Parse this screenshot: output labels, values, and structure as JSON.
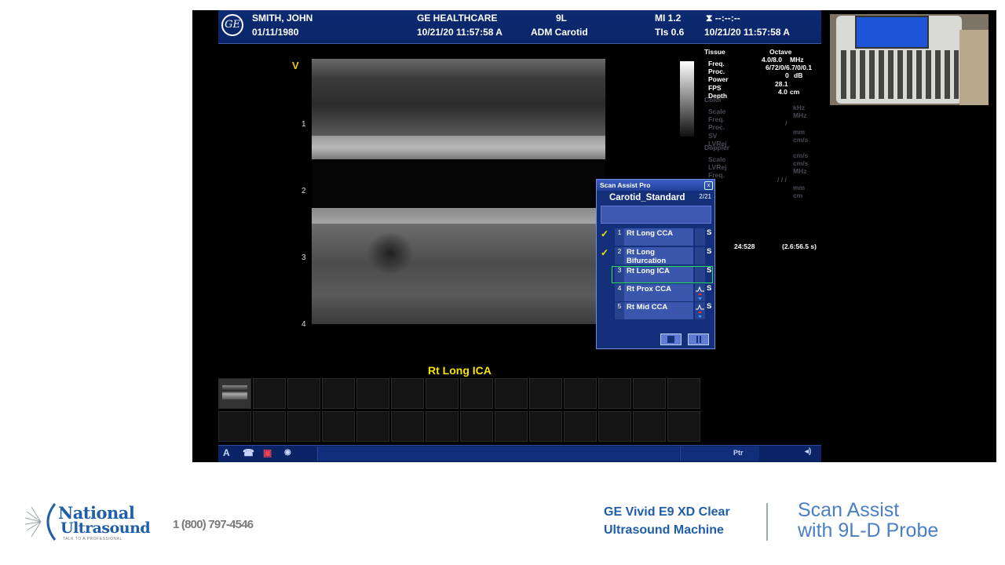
{
  "header": {
    "patient_name": "SMITH, JOHN",
    "patient_dob": "01/11/1980",
    "institution": "GE HEALTHCARE",
    "datetime": "10/21/20 11:57:58 A",
    "probe": "9L",
    "operator_app": "ADM Carotid",
    "mi": "MI 1.2",
    "tis": "TIs 0.6",
    "status_icon_text": "--:--:--",
    "datetime_right": "10/21/20 11:57:58 A",
    "logo_text": "GE"
  },
  "image": {
    "orientation_marker": "V",
    "depth_ticks": [
      "1",
      "2",
      "3",
      "4"
    ],
    "label": "Rt Long ICA"
  },
  "params": {
    "tissue_label": "Tissue",
    "tissue_value": "Octave",
    "rows": [
      {
        "name": "Freq.",
        "value": "4.0/8.0",
        "unit": "MHz"
      },
      {
        "name": "Proc.",
        "value": "6/72/0/6.7/0/0.1",
        "unit": ""
      },
      {
        "name": "Power",
        "value": "0",
        "unit": "dB"
      },
      {
        "name": "FPS",
        "value": "28.1",
        "unit": ""
      },
      {
        "name": "Depth",
        "value": "4.0",
        "unit": "cm"
      }
    ],
    "color_label": "Color",
    "color_rows": [
      {
        "name": "Scale",
        "unit": "kHz"
      },
      {
        "name": "Freq.",
        "unit": "MHz"
      },
      {
        "name": "Proc.",
        "unit": "/"
      },
      {
        "name": "SV",
        "unit": "mm"
      },
      {
        "name": "LVRej",
        "unit": "cm/s"
      }
    ],
    "doppler_label": "Doppler",
    "doppler_rows": [
      {
        "name": "Scale",
        "unit": "cm/s"
      },
      {
        "name": "LVRej",
        "unit": "cm/s"
      },
      {
        "name": "Freq.",
        "unit": "MHz"
      }
    ],
    "extra_units": [
      "/ / /",
      "mm",
      "cm"
    ],
    "time_left": "24:528",
    "time_right": "(2.6:56.5 s)"
  },
  "scan_assist": {
    "title": "Scan Assist Pro",
    "close": "x",
    "protocol": "Carotid_Standard",
    "count": "2/21",
    "steps": [
      {
        "num": "1",
        "label": "Rt Long CCA",
        "done": true,
        "s": "S",
        "check": "✓"
      },
      {
        "num": "2",
        "label": "Rt Long Bifurcation",
        "done": true,
        "s": "S",
        "check": "✓"
      },
      {
        "num": "3",
        "label": "Rt Long ICA",
        "done": false,
        "s": "S",
        "check": ""
      },
      {
        "num": "4",
        "label": "Rt Prox CCA",
        "done": false,
        "s": "S",
        "check": ""
      },
      {
        "num": "5",
        "label": "Rt Mid CCA",
        "done": false,
        "s": "S",
        "check": ""
      }
    ]
  },
  "bottom_bar": {
    "label_a": "A",
    "ptr": "Ptr"
  },
  "footer": {
    "brand_line1": "National",
    "brand_line2": "Ultrasound",
    "brand_tagline": "TALK TO A PROFESSIONAL",
    "phone": "1 (800) 797-4546",
    "machine_line1": "GE Vivid E9 XD Clear",
    "machine_line2": "Ultrasound Machine",
    "subject_line1": "Scan Assist",
    "subject_line2": "with 9L-D Probe"
  },
  "colors": {
    "header_blue": "#0d2b73",
    "label_yellow": "#f7e300",
    "brand_blue": "#1f5ea8",
    "select_green": "#27e05a"
  }
}
